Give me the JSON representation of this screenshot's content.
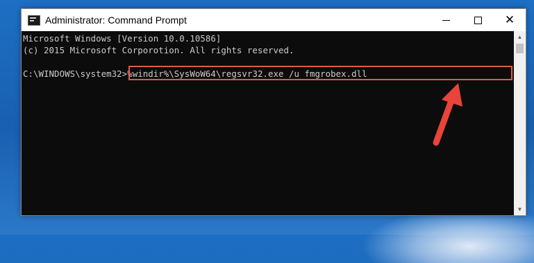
{
  "window": {
    "title": "Administrator: Command Prompt",
    "controls": {
      "minimize": "minimize",
      "maximize": "maximize",
      "close": "✕"
    }
  },
  "console": {
    "lines": [
      "Microsoft Windows [Version 10.0.10586]",
      "(c) 2015 Microsoft Corporotion. All rights reserved."
    ],
    "prompt": "C:\\WINDOWS\\system32>",
    "command": "%windir%\\SysWoW64\\regsvr32.exe /u fmgrobex.dll"
  },
  "colors": {
    "console_bg": "#0c0c0c",
    "console_text": "#cccccc",
    "highlight": "#e05a4a",
    "arrow": "#e8443a",
    "desktop": "#1d6fc4"
  },
  "icons": {
    "app": "cmd-icon",
    "scroll_up": "chevron-up-icon",
    "scroll_down": "chevron-down-icon",
    "annotation": "red-arrow-icon"
  }
}
